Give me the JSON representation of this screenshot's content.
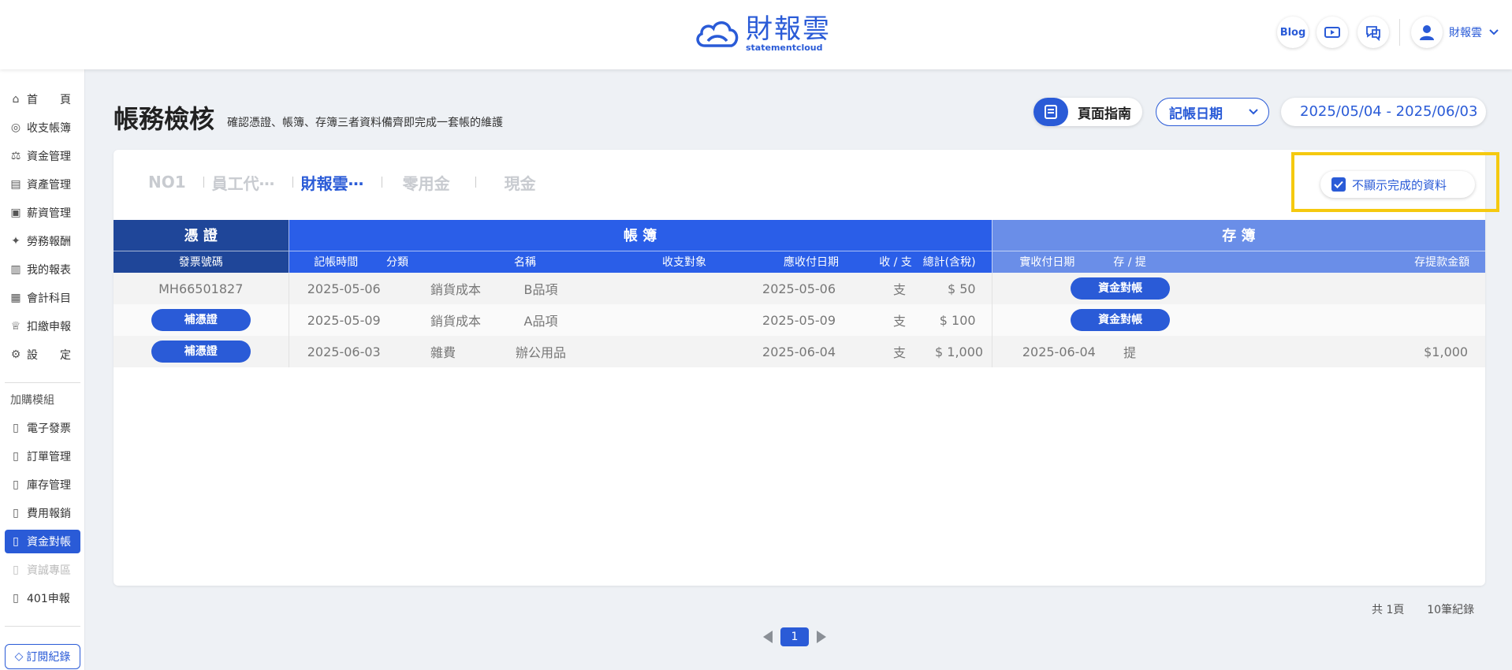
{
  "header": {
    "logo_title": "財報雲",
    "logo_sub": "statementcloud",
    "blog_label": "Blog",
    "user_name": "財報雲"
  },
  "sidebar": {
    "items": [
      {
        "label": "首　　頁",
        "icon": "home-icon"
      },
      {
        "label": "收支帳簿",
        "icon": "coin-icon"
      },
      {
        "label": "資金管理",
        "icon": "fund-icon"
      },
      {
        "label": "資產管理",
        "icon": "asset-icon"
      },
      {
        "label": "薪資管理",
        "icon": "salary-icon"
      },
      {
        "label": "勞務報酬",
        "icon": "labor-icon"
      },
      {
        "label": "我的報表",
        "icon": "report-icon"
      },
      {
        "label": "會計科目",
        "icon": "account-icon"
      },
      {
        "label": "扣繳申報",
        "icon": "withholding-icon"
      },
      {
        "label": "設　　定",
        "icon": "settings-icon"
      }
    ],
    "addon_label": "加購模組",
    "addons": [
      {
        "label": "電子發票",
        "state": "normal"
      },
      {
        "label": "訂單管理",
        "state": "normal"
      },
      {
        "label": "庫存管理",
        "state": "normal"
      },
      {
        "label": "費用報銷",
        "state": "normal"
      },
      {
        "label": "資金對帳",
        "state": "active"
      },
      {
        "label": "資誠專區",
        "state": "disabled"
      },
      {
        "label": "401申報",
        "state": "normal"
      }
    ],
    "subscribe_label": "訂閱紀錄"
  },
  "page": {
    "title": "帳務檢核",
    "subtitle": "確認憑證、帳簿、存簿三者資料備齊即完成一套帳的維護",
    "guide_label": "頁面指南",
    "date_select_label": "記帳日期",
    "date_range": "2025/05/04 - 2025/06/03"
  },
  "tabs": [
    {
      "label": "NO1",
      "active": false
    },
    {
      "label": "員工代⋯",
      "active": false
    },
    {
      "label": "財報雲⋯",
      "active": true
    },
    {
      "label": "零用金",
      "active": false
    },
    {
      "label": "現金",
      "active": false
    }
  ],
  "filter": {
    "hide_done_label": "不顯示完成的資料",
    "checked": true
  },
  "table": {
    "groups": {
      "voucher": "憑 證",
      "ledger": "帳 簿",
      "bank": "存 簿"
    },
    "columns": {
      "invoice_no": "發票號碼",
      "record_time": "記帳時間",
      "category": "分類",
      "name": "名稱",
      "counterparty": "收支對象",
      "due_date": "應收付日期",
      "in_out": "收 / 支",
      "total": "總計(含稅)",
      "actual_date": "實收付日期",
      "deposit_withdraw": "存 / 提",
      "withdraw_amount": "存提款金額"
    },
    "rows": [
      {
        "invoice_no": "MH66501827",
        "invoice_button": "",
        "record_time": "2025-05-06",
        "category": "銷貨成本",
        "name": "B品項",
        "counterparty": "",
        "due_date": "2025-05-06",
        "in_out": "支",
        "total": "$ 50",
        "actual_date": "",
        "deposit_withdraw": "",
        "bank_button": "資金對帳",
        "withdraw_amount": ""
      },
      {
        "invoice_no": "",
        "invoice_button": "補憑證",
        "record_time": "2025-05-09",
        "category": "銷貨成本",
        "name": "A品項",
        "counterparty": "",
        "due_date": "2025-05-09",
        "in_out": "支",
        "total": "$ 100",
        "actual_date": "",
        "deposit_withdraw": "",
        "bank_button": "資金對帳",
        "withdraw_amount": ""
      },
      {
        "invoice_no": "",
        "invoice_button": "補憑證",
        "record_time": "2025-06-03",
        "category": "雜費",
        "name": "辦公用品",
        "counterparty": "",
        "due_date": "2025-06-04",
        "in_out": "支",
        "total": "$ 1,000",
        "actual_date": "2025-06-04",
        "deposit_withdraw": "提",
        "bank_button": "",
        "withdraw_amount": "$1,000"
      }
    ]
  },
  "footer": {
    "pages_text": "共 1頁",
    "records_text": "10筆紀錄",
    "current_page": "1"
  },
  "colors": {
    "accent": "#2a5bd7",
    "voucher_header": "#1f4699",
    "ledger_header": "#2a5ee8",
    "bank_header": "#6a8ee8",
    "highlight": "#f5c90f"
  }
}
